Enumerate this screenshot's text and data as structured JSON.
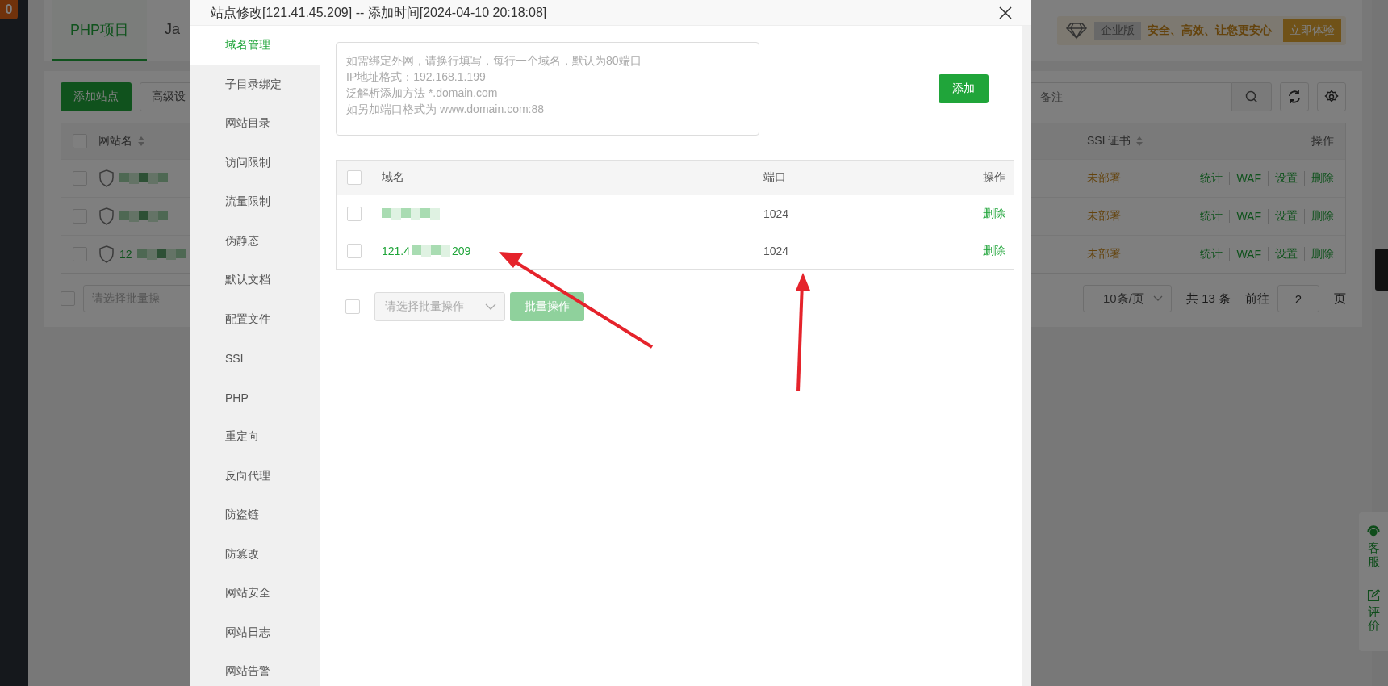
{
  "left_nav": {
    "badge": "0"
  },
  "tabs": [
    {
      "label": "PHP项目",
      "selected": true
    },
    {
      "label": "Ja",
      "selected": false
    }
  ],
  "promo": {
    "edition": "企业版",
    "slogan": "安全、高效、让您更安心",
    "button": "立即体验"
  },
  "toolbar": {
    "add_button": "添加站点",
    "advanced_button": "高级设",
    "search": {
      "placeholder": "备注"
    }
  },
  "site_table": {
    "all_checked": false,
    "columns": [
      "网站名",
      "SSL证书",
      "操作"
    ],
    "rows": [
      {
        "checked": false,
        "ssl": "未部署",
        "actions": [
          "统计",
          "WAF",
          "设置",
          "删除"
        ]
      },
      {
        "checked": false,
        "ssl": "未部署",
        "actions": [
          "统计",
          "WAF",
          "设置",
          "删除"
        ]
      },
      {
        "checked": false,
        "name_start": "12",
        "ssl": "未部署",
        "actions": [
          "统计",
          "WAF",
          "设置",
          "删除"
        ]
      }
    ]
  },
  "batch_select": {
    "checked": false,
    "placeholder": "请选择批量操"
  },
  "pagination": {
    "page_size": "10条/页",
    "total": "共 13 条",
    "goto_label": "前往",
    "page": "2",
    "page_suffix": "页"
  },
  "side_float": [
    {
      "kind": "headset",
      "label": "客服"
    },
    {
      "kind": "edit",
      "label": "评价"
    }
  ],
  "dialog": {
    "title": "站点修改[121.41.45.209] -- 添加时间[2024-04-10 20:18:08]",
    "menu": [
      {
        "label": "域名管理",
        "selected": true
      },
      {
        "label": "子目录绑定",
        "selected": false
      },
      {
        "label": "网站目录",
        "selected": false
      },
      {
        "label": "访问限制",
        "selected": false
      },
      {
        "label": "流量限制",
        "selected": false
      },
      {
        "label": "伪静态",
        "selected": false
      },
      {
        "label": "默认文档",
        "selected": false
      },
      {
        "label": "配置文件",
        "selected": false
      },
      {
        "label": "SSL",
        "selected": false
      },
      {
        "label": "PHP",
        "selected": false
      },
      {
        "label": "重定向",
        "selected": false
      },
      {
        "label": "反向代理",
        "selected": false
      },
      {
        "label": "防盗链",
        "selected": false
      },
      {
        "label": "防篡改",
        "selected": false
      },
      {
        "label": "网站安全",
        "selected": false
      },
      {
        "label": "网站日志",
        "selected": false
      },
      {
        "label": "网站告警",
        "selected": false
      }
    ],
    "domain_input": {
      "placeholder": "如需绑定外网，请换行填写，每行一个域名，默认为80端口\nIP地址格式：192.168.1.199\n泛解析添加方法 *.domain.com\n如另加端口格式为 www.domain.com:88"
    },
    "add_button": "添加",
    "table": {
      "all_checked": false,
      "columns": [
        "域名",
        "端口",
        "操作"
      ],
      "rows": [
        {
          "checked": false,
          "port": "1024",
          "action": "删除"
        },
        {
          "checked": false,
          "domain_start": "121.4",
          "domain_end": "209",
          "port": "1024",
          "action": "删除"
        }
      ]
    },
    "batch": {
      "checked": false,
      "placeholder": "请选择批量操作",
      "button": "批量操作"
    }
  }
}
